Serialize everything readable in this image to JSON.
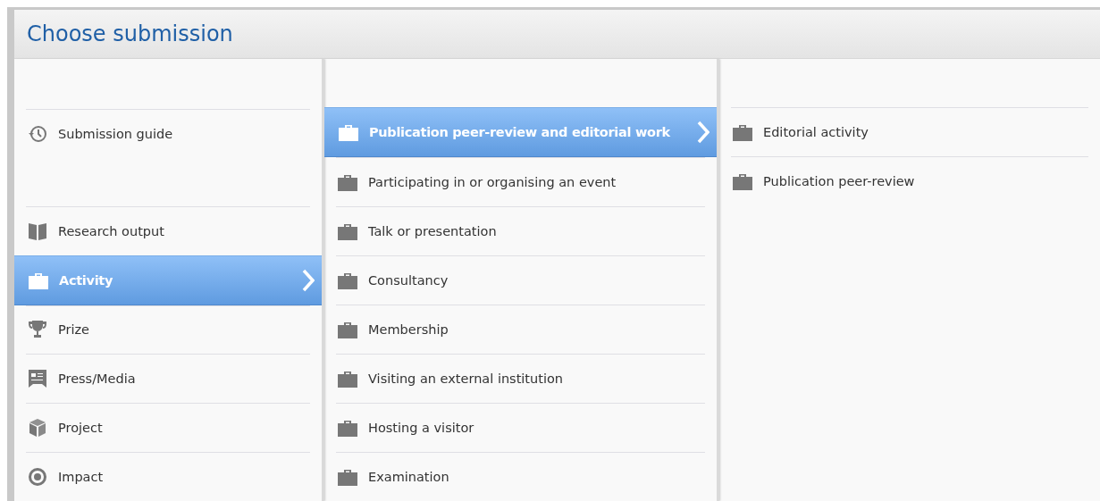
{
  "window": {
    "title": "Choose submission"
  },
  "categories": {
    "groups": [
      {
        "items": [
          {
            "label": "Submission guide",
            "kind": "clock",
            "selected": false
          }
        ]
      },
      {
        "items": [
          {
            "label": "Research output",
            "kind": "book",
            "selected": false
          },
          {
            "label": "Activity",
            "kind": "briefcase",
            "selected": true
          },
          {
            "label": "Prize",
            "kind": "trophy",
            "selected": false
          },
          {
            "label": "Press/Media",
            "kind": "press",
            "selected": false
          },
          {
            "label": "Project",
            "kind": "cube",
            "selected": false
          },
          {
            "label": "Impact",
            "kind": "target",
            "selected": false
          }
        ]
      }
    ]
  },
  "activity_types": [
    {
      "label": "Publication peer-review and editorial work",
      "selected": true
    },
    {
      "label": "Participating in or organising an event",
      "selected": false
    },
    {
      "label": "Talk or presentation",
      "selected": false
    },
    {
      "label": "Consultancy",
      "selected": false
    },
    {
      "label": "Membership",
      "selected": false
    },
    {
      "label": "Visiting an external institution",
      "selected": false
    },
    {
      "label": "Hosting a visitor",
      "selected": false
    },
    {
      "label": "Examination",
      "selected": false
    }
  ],
  "subtypes": [
    {
      "label": "Editorial activity",
      "selected": false
    },
    {
      "label": "Publication peer-review",
      "selected": false
    }
  ]
}
